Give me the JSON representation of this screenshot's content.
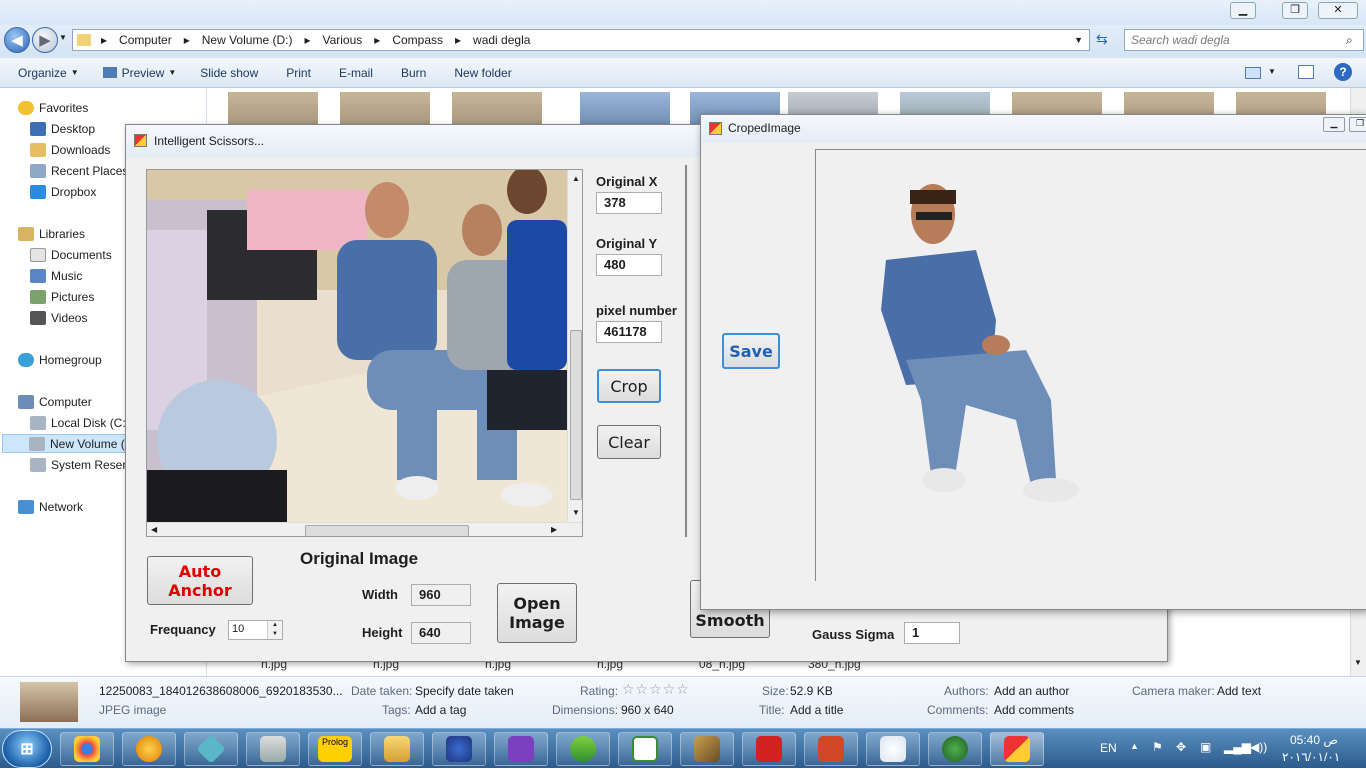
{
  "explorer": {
    "window_title": "Compass",
    "breadcrumb": [
      "Computer",
      "New Volume (D:)",
      "Various",
      "Compass",
      "wadi degla"
    ],
    "search_placeholder": "Search wadi degla",
    "toolbar": [
      "Organize",
      "Preview",
      "Slide show",
      "Print",
      "E-mail",
      "Burn",
      "New folder"
    ],
    "nav": {
      "favorites_header": "Favorites",
      "favorites": [
        "Desktop",
        "Downloads",
        "Recent Places",
        "Dropbox"
      ],
      "libraries_header": "Libraries",
      "libraries": [
        "Documents",
        "Music",
        "Pictures",
        "Videos"
      ],
      "homegroup": "Homegroup",
      "computer_header": "Computer",
      "drives": [
        "Local Disk (C:)",
        "New Volume (",
        "System Reserv"
      ],
      "network": "Network"
    },
    "thumb_names": [
      "h.jpg",
      "h.jpg",
      "h.jpg",
      "h.jpg",
      "08_h.jpg",
      "380_h.jpg"
    ],
    "details": {
      "file_name": "12250083_184012638608006_6920183530...",
      "file_type": "JPEG image",
      "date_taken_label": "Date taken:",
      "date_taken_value": "Specify date taken",
      "tags_label": "Tags:",
      "tags_value": "Add a tag",
      "rating_label": "Rating:",
      "rating_stars": "☆☆☆☆☆",
      "dimensions_label": "Dimensions:",
      "dimensions_value": "960 x 640",
      "size_label": "Size:",
      "size_value": "52.9 KB",
      "title_label": "Title:",
      "title_value": "Add a title",
      "authors_label": "Authors:",
      "authors_value": "Add an author",
      "comments_label": "Comments:",
      "comments_value": "Add comments",
      "camera_label": "Camera maker:",
      "camera_value": "Add text"
    }
  },
  "scissors": {
    "title": "Intelligent Scissors...",
    "original_x_label": "Original X",
    "original_x": "378",
    "original_y_label": "Original Y",
    "original_y": "480",
    "pixel_number_label": "pixel number",
    "pixel_number": "461178",
    "crop_label": "Crop",
    "clear_label": "Clear",
    "auto_anchor_label": "Auto Anchor",
    "frequancy_label": "Frequancy",
    "frequancy_value": "10",
    "original_image_label": "Original Image",
    "width_label": "Width",
    "width_value": "960",
    "height_label": "Height",
    "height_value": "640",
    "open_image_label": "Open Image",
    "smooth_label": "Smooth",
    "gauss_sigma_label": "Gauss Sigma",
    "gauss_sigma_value": "1"
  },
  "cropped": {
    "title": "CropedImage",
    "save_label": "Save"
  },
  "taskbar": {
    "language": "EN",
    "time": "05:40 ص",
    "date": "٢٠١٦/٠١/٠١"
  },
  "colors": {
    "auto_anchor_text": "#e00000",
    "save_text": "#1f5fb8"
  }
}
